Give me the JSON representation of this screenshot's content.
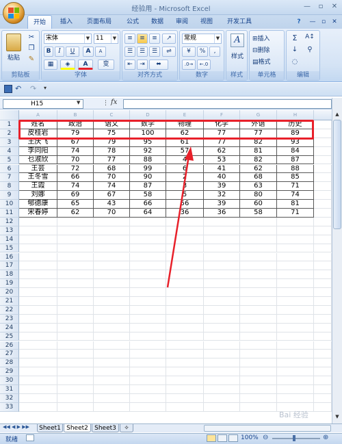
{
  "window": {
    "title": "经验用 - Microsoft Excel"
  },
  "window_buttons": [
    "—",
    "▫",
    "✕"
  ],
  "ribbon_tabs": [
    "开始",
    "插入",
    "页面布局",
    "公式",
    "数据",
    "审阅",
    "视图",
    "开发工具"
  ],
  "ribbon_right_icons": [
    "?",
    "—",
    "▫",
    "✕"
  ],
  "groups": {
    "clipboard": {
      "label": "剪贴板",
      "paste": "粘贴"
    },
    "font": {
      "label": "字体",
      "font_name": "宋体",
      "font_size": "11",
      "bold": "B",
      "italic": "I",
      "underline": "U",
      "grow": "A",
      "shrink": "A",
      "font_color": "A",
      "wen": "变"
    },
    "alignment": {
      "label": "对齐方式"
    },
    "number": {
      "label": "数字",
      "format": "常规",
      "currency": "%",
      "percent": "%",
      "comma": ","
    },
    "styles": {
      "label": "样式",
      "button": "样式"
    },
    "cells": {
      "label": "单元格",
      "insert": "插入",
      "delete": "删除",
      "format": "格式"
    },
    "editing": {
      "label": "编辑",
      "sum": "Σ",
      "sort": "A",
      "fill": "↓",
      "clear": "2"
    }
  },
  "formula_bar": {
    "name_box": "H15",
    "fx": "fx",
    "value": ""
  },
  "columns": [
    "A",
    "B",
    "C",
    "D",
    "E",
    "F",
    "G",
    "H"
  ],
  "rows": [
    "1",
    "2",
    "3",
    "4",
    "5",
    "6",
    "7",
    "8",
    "9",
    "10",
    "11",
    "12",
    "13",
    "14",
    "15",
    "16",
    "17",
    "18",
    "19",
    "20",
    "21",
    "22",
    "23",
    "24",
    "25",
    "26",
    "27",
    "28",
    "29",
    "30",
    "31",
    "32",
    "33"
  ],
  "table": [
    [
      "姓名",
      "政治",
      "语文",
      "数学",
      "物理",
      "化学",
      "外语",
      "历史"
    ],
    [
      "皮桂岩",
      "79",
      "75",
      "100",
      "62",
      "77",
      "77",
      "89"
    ],
    [
      "王庆飞",
      "67",
      "79",
      "95",
      "61",
      "77",
      "82",
      "93"
    ],
    [
      "李同阳",
      "74",
      "78",
      "92",
      "57",
      "62",
      "81",
      "84"
    ],
    [
      "乜淑欣",
      "70",
      "77",
      "88",
      "4",
      "53",
      "82",
      "87"
    ],
    [
      "王芸",
      "72",
      "68",
      "99",
      "6",
      "41",
      "62",
      "88"
    ],
    [
      "王冬雪",
      "66",
      "70",
      "90",
      "2",
      "40",
      "68",
      "85"
    ],
    [
      "王霞",
      "74",
      "74",
      "87",
      "3",
      "39",
      "63",
      "71"
    ],
    [
      "刘娜",
      "69",
      "67",
      "58",
      "5",
      "32",
      "80",
      "74"
    ],
    [
      "郇德康",
      "65",
      "43",
      "66",
      "56",
      "39",
      "60",
      "81"
    ],
    [
      "宋春婷",
      "62",
      "70",
      "64",
      "36",
      "36",
      "58",
      "71"
    ]
  ],
  "sheets": [
    "Sheet1",
    "Sheet2",
    "Sheet3"
  ],
  "active_sheet": 1,
  "status": {
    "ready": "就绪",
    "zoom": "100%"
  },
  "watermark": "Bai 经验",
  "colors": {
    "highlight": "#e8202a",
    "accent": "#15428b"
  }
}
